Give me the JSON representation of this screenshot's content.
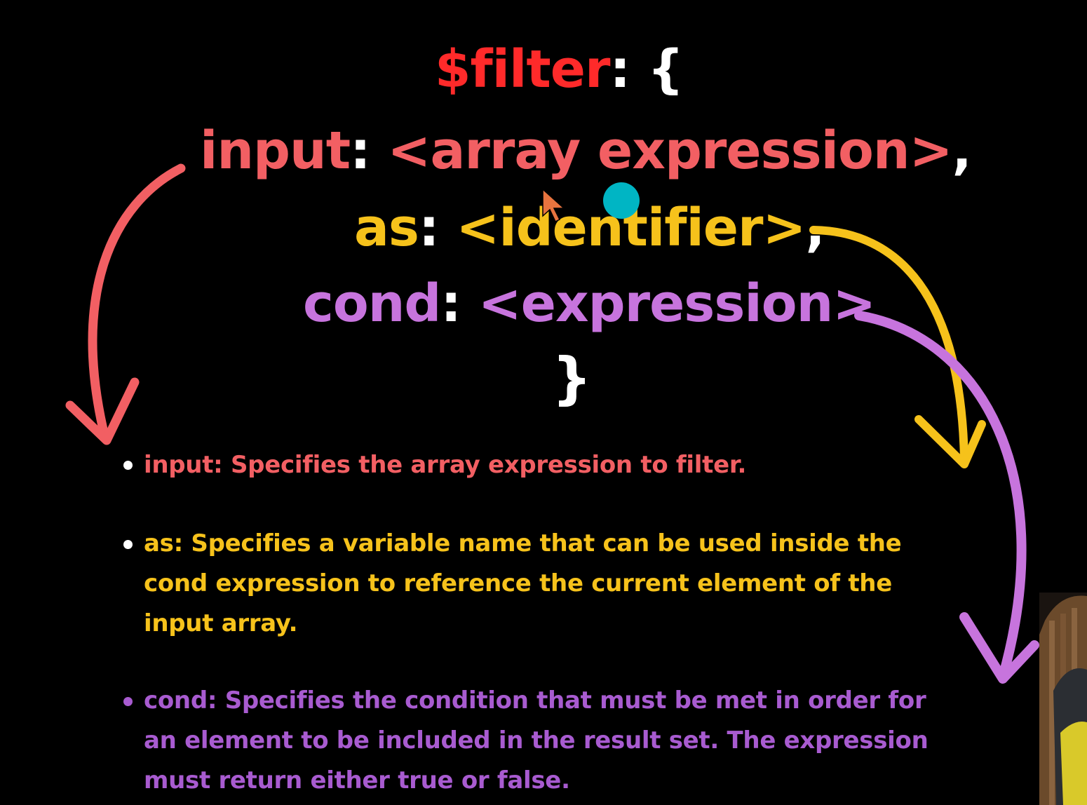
{
  "code": {
    "line1": {
      "key": "$filter",
      "rest": ": {"
    },
    "line2": {
      "key": "input",
      "colon": ":",
      "value": " <array expression>",
      "suffix": ","
    },
    "line3": {
      "key": "as",
      "colon": ":",
      "value": " <identifier>",
      "suffix": ","
    },
    "line4": {
      "key": "cond",
      "colon": ":",
      "value": " <expression>"
    },
    "line5": {
      "close": "}"
    }
  },
  "bullets": [
    {
      "lines": [
        "input: Specifies the array expression to filter."
      ]
    },
    {
      "lines": [
        "as: Specifies a variable name that can be used inside the",
        "cond expression to reference the current element of the",
        "input array."
      ]
    },
    {
      "lines": [
        "cond: Specifies the condition that must be met in order for",
        "an element to be included in the result set. The expression",
        "must return either true or false."
      ]
    }
  ],
  "colors": {
    "background": "#000000",
    "filter": "#ff2a2a",
    "input": "#f25f63",
    "as": "#f6c21b",
    "cond": "#c774dd",
    "bullet_cond_text": "#a85bd0",
    "punctuation": "#ffffff",
    "cursor_dot": "#00b5c4",
    "cursor_arrow": "#e8743f"
  },
  "icons": {
    "cursor": "mouse-pointer-icon",
    "arrows": [
      "curved-arrow-red-icon",
      "curved-arrow-yellow-icon",
      "curved-arrow-purple-icon"
    ]
  }
}
